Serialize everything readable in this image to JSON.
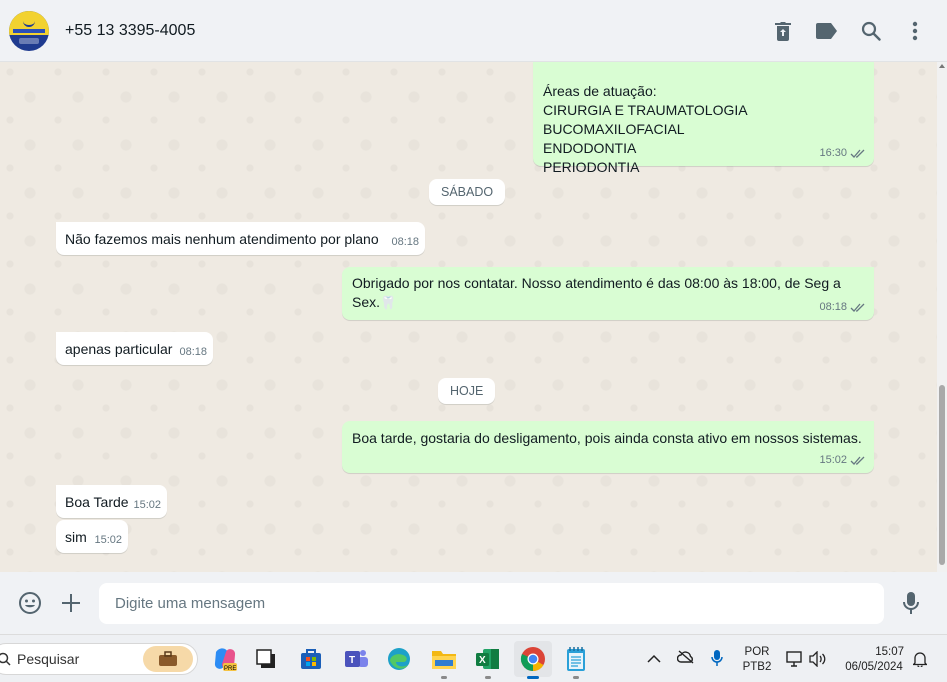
{
  "header": {
    "contact_name": "+55 13 3395-4005",
    "icons": [
      "delete-icon",
      "label-icon",
      "search-icon",
      "menu-icon"
    ]
  },
  "messages": [
    {
      "dir": "out",
      "lines": [
        "Áreas de atuação:",
        "CIRURGIA E TRAUMATOLOGIA BUCOMAXILOFACIAL",
        "ENDODONTIA",
        "PERIODONTIA"
      ],
      "time": "16:30",
      "status": "read"
    },
    {
      "dir": "day",
      "text": "SÁBADO"
    },
    {
      "dir": "in",
      "text": "Não fazemos mais nenhum atendimento por plano",
      "time": "08:18"
    },
    {
      "dir": "out",
      "text": "Obrigado por nos contatar. Nosso atendimento é das 08:00 às 18:00, de Seg a Sex.",
      "emoji": "🦷",
      "time": "08:18",
      "status": "read"
    },
    {
      "dir": "in",
      "text": "apenas particular",
      "time": "08:18"
    },
    {
      "dir": "day",
      "text": "HOJE"
    },
    {
      "dir": "out",
      "text": "Boa tarde, gostaria do desligamento, pois ainda consta ativo em nossos sistemas.",
      "time": "15:02",
      "status": "read"
    },
    {
      "dir": "in",
      "text": "Boa Tarde",
      "time": "15:02"
    },
    {
      "dir": "in",
      "text": "sim",
      "time": "15:02"
    }
  ],
  "composer": {
    "placeholder": "Digite uma mensagem"
  },
  "taskbar": {
    "search_label": "Pesquisar",
    "apps": [
      "work-bag-icon",
      "copilot-icon",
      "task-view-icon",
      "store-icon",
      "teams-icon",
      "edge-icon",
      "file-explorer-icon",
      "excel-icon",
      "chrome-icon",
      "notepad-icon"
    ],
    "language": "POR",
    "layout": "PTB2",
    "time": "15:07",
    "date": "06/05/2024"
  },
  "colors": {
    "outgoing_bubble": "#d9fdd3",
    "incoming_bubble": "#ffffff",
    "chat_background": "#efeae2",
    "read_ticks": "#667781"
  }
}
